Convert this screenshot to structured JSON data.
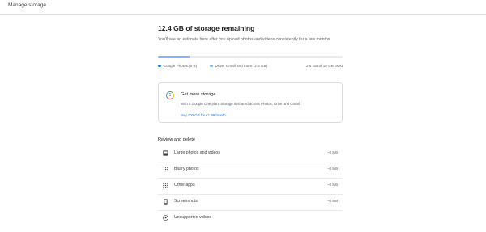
{
  "header": {
    "title": "Manage storage"
  },
  "storage": {
    "headline": "12.4 GB of storage remaining",
    "subtext": "You'll see an estimate here after you upload photos and videos consistently for a few months",
    "used_fraction_total": 0.173,
    "used_fraction_photos": 0.0,
    "legend": {
      "photos": "Google Photos (0 B)",
      "drive": "Drive, Gmail and more (2.6 GB)",
      "total": "2.6 GB of 15 GB used"
    },
    "colors": {
      "photos": "#1a73e8",
      "drive": "#8ab4f8"
    }
  },
  "upsell": {
    "icon": "google-one-icon",
    "badge": "1",
    "title": "Get more storage",
    "description": "With a Google One plan. Storage is shared across Photos, Drive and Gmail",
    "link": "Buy 100 GB for €1.99/month"
  },
  "review": {
    "title": "Review and delete",
    "items": [
      {
        "label": "Large photos and videos",
        "size": "~0 MB",
        "icon": "large-media-icon"
      },
      {
        "label": "Blurry photos",
        "size": "~0 MB",
        "icon": "blurry-photo-icon"
      },
      {
        "label": "Other apps",
        "size": "~0 MB",
        "icon": "apps-grid-icon"
      },
      {
        "label": "Screenshots",
        "size": "~0 MB",
        "icon": "screenshot-icon"
      },
      {
        "label": "Unsupported videos",
        "size": "",
        "icon": "unsupported-video-icon"
      }
    ]
  }
}
